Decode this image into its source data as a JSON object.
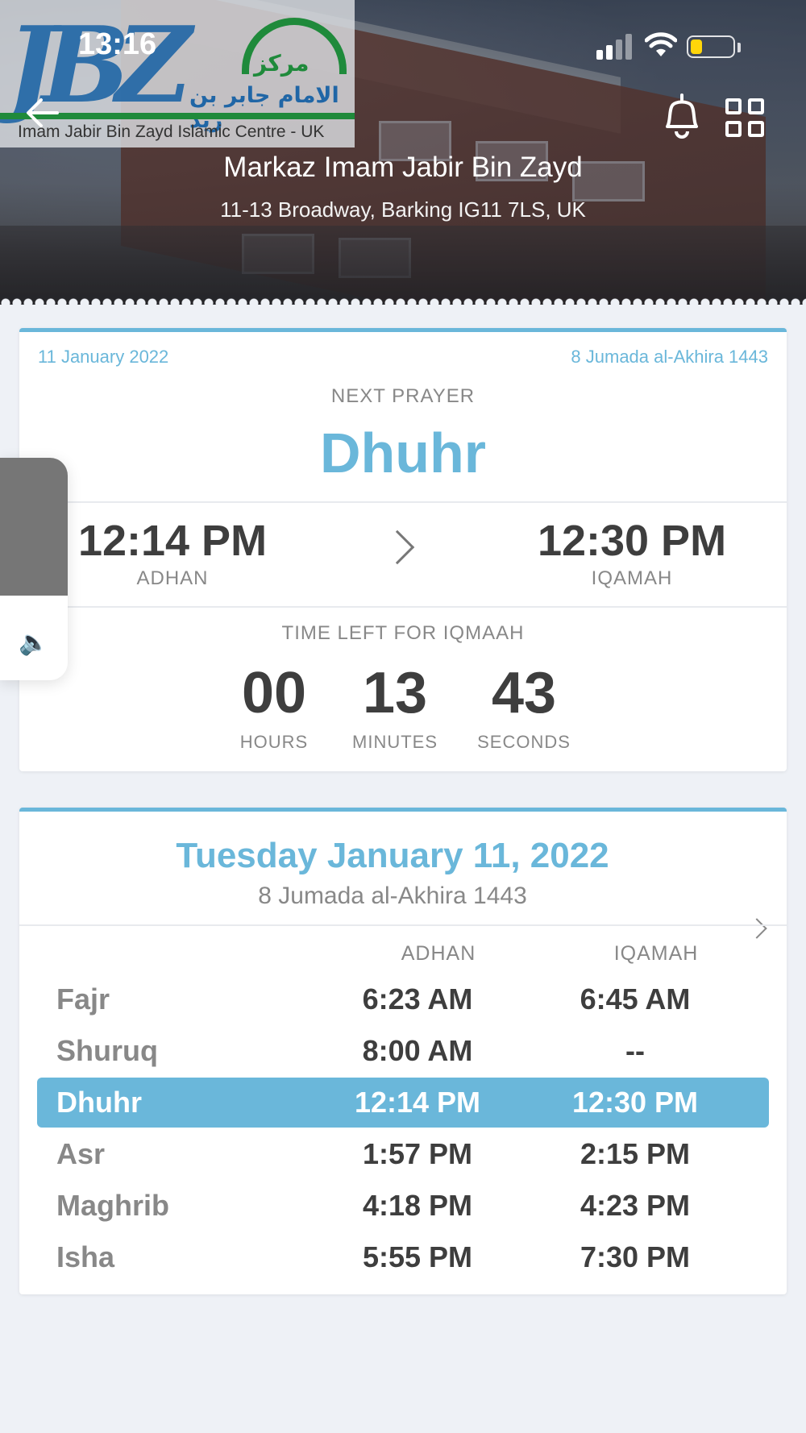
{
  "status_bar": {
    "time": "13:16",
    "battery_level": 0.25,
    "battery_color": "#ffd60a"
  },
  "header": {
    "logo": {
      "letters": "JBZ",
      "arabic_line1": "مركز",
      "arabic_line2": "الامام جابر بن زيد",
      "subtitle": "Imam Jabir Bin Zayd Islamic Centre - UK"
    },
    "mosque_name": "Markaz Imam Jabir Bin Zayd",
    "address": "11-13 Broadway, Barking IG11 7LS, UK",
    "icons": [
      "back-arrow-icon",
      "bell-icon",
      "grid-menu-icon"
    ]
  },
  "next_prayer": {
    "gregorian_date": "11 January 2022",
    "hijri_date": "8 Jumada al-Akhira 1443",
    "label": "NEXT PRAYER",
    "name": "Dhuhr",
    "adhan_time": "12:14 PM",
    "adhan_label": "ADHAN",
    "iqamah_time": "12:30 PM",
    "iqamah_label": "IQAMAH",
    "countdown_label": "TIME LEFT FOR IQMAAH",
    "countdown": {
      "hours": "00",
      "hours_label": "HOURS",
      "minutes": "13",
      "minutes_label": "MINUTES",
      "seconds": "43",
      "seconds_label": "SECONDS"
    }
  },
  "volume_hud": {
    "level": 0.62
  },
  "schedule": {
    "day_title": "Tuesday January 11, 2022",
    "hijri": "8 Jumada al-Akhira 1443",
    "col_adhan": "ADHAN",
    "col_iqamah": "IQAMAH",
    "rows": [
      {
        "name": "Fajr",
        "adhan": "6:23 AM",
        "iqamah": "6:45 AM",
        "active": false
      },
      {
        "name": "Shuruq",
        "adhan": "8:00 AM",
        "iqamah": "--",
        "active": false
      },
      {
        "name": "Dhuhr",
        "adhan": "12:14 PM",
        "iqamah": "12:30 PM",
        "active": true
      },
      {
        "name": "Asr",
        "adhan": "1:57 PM",
        "iqamah": "2:15 PM",
        "active": false
      },
      {
        "name": "Maghrib",
        "adhan": "4:18 PM",
        "iqamah": "4:23 PM",
        "active": false
      },
      {
        "name": "Isha",
        "adhan": "5:55 PM",
        "iqamah": "7:30 PM",
        "active": false
      }
    ]
  },
  "colors": {
    "accent": "#6ab7da",
    "background": "#eef1f6",
    "logo_green": "#1f8a3b",
    "logo_blue": "#2066a6"
  }
}
